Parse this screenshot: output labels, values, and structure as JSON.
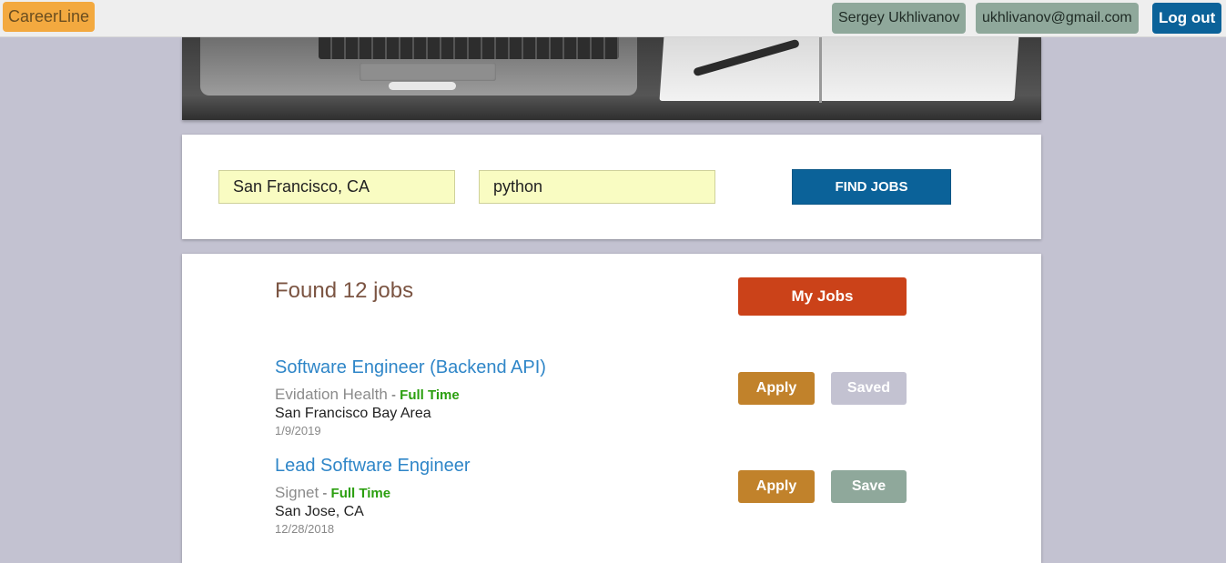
{
  "header": {
    "brand": "CareerLine",
    "user_name": "Sergey Ukhlivanov",
    "user_email": "ukhlivanov@gmail.com",
    "logout_label": "Log out"
  },
  "search": {
    "location_value": "San Francisco, CA",
    "keyword_value": "python",
    "find_label": "FIND JOBS"
  },
  "results": {
    "summary": "Found 12 jobs",
    "my_jobs_label": "My Jobs",
    "jobs": [
      {
        "title": "Software Engineer (Backend API)",
        "company": "Evidation Health",
        "separator": " - ",
        "type": "Full Time",
        "location": "San Francisco Bay Area",
        "date": "1/9/2019",
        "apply_label": "Apply",
        "save_label": "Saved"
      },
      {
        "title": "Lead Software Engineer",
        "company": "Signet",
        "separator": " - ",
        "type": "Full Time",
        "location": "San Jose, CA",
        "date": "12/28/2018",
        "apply_label": "Apply",
        "save_label": "Save"
      }
    ]
  },
  "colors": {
    "brand": "#f3a93f",
    "primary": "#0b6299",
    "my_jobs": "#cb4219",
    "apply": "#c1822b",
    "save": "#8fa89b",
    "saved": "#c3c2d1",
    "job_title": "#2f86c8",
    "job_type": "#2b9f0f"
  }
}
